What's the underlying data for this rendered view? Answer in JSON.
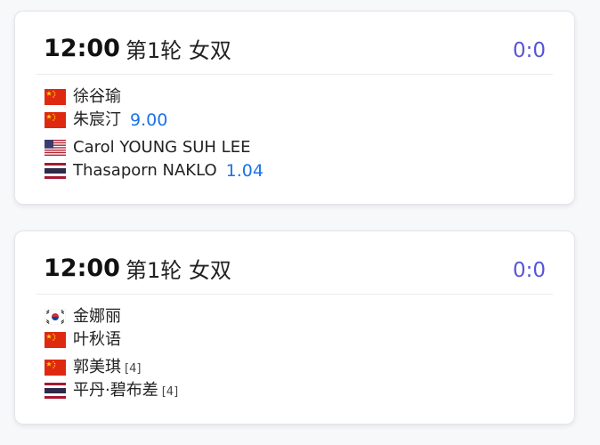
{
  "matches": [
    {
      "time": "12:00",
      "round": "第1轮 女双",
      "score": "0:0",
      "teams": [
        {
          "players": [
            {
              "name": "徐谷瑜",
              "flag": "china-flag-icon"
            },
            {
              "name": "朱宸汀",
              "flag": "china-flag-icon"
            }
          ],
          "odds": "9.00",
          "seed": ""
        },
        {
          "players": [
            {
              "name": "Carol YOUNG SUH LEE",
              "flag": "usa-flag-icon"
            },
            {
              "name": "Thasaporn NAKLO",
              "flag": "thailand-flag-icon"
            }
          ],
          "odds": "1.04",
          "seed": ""
        }
      ]
    },
    {
      "time": "12:00",
      "round": "第1轮 女双",
      "score": "0:0",
      "teams": [
        {
          "players": [
            {
              "name": "金娜丽",
              "flag": "south-korea-flag-icon"
            },
            {
              "name": "叶秋语",
              "flag": "china-flag-icon"
            }
          ],
          "odds": "",
          "seed": ""
        },
        {
          "players": [
            {
              "name": "郭美琪",
              "flag": "china-flag-icon"
            },
            {
              "name": "平丹·碧布差",
              "flag": "thailand-flag-icon"
            }
          ],
          "odds": "",
          "seed": "[4]"
        }
      ]
    }
  ],
  "colors": {
    "score": "#5856d6",
    "odds": "#1a73e8"
  }
}
